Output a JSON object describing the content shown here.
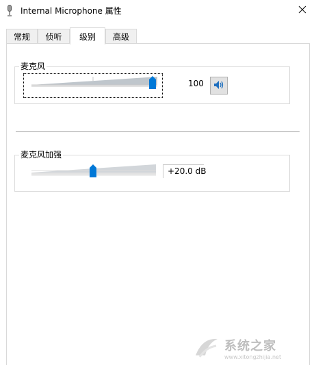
{
  "window": {
    "title": "Internal Microphone 属性",
    "icon": "microphone-icon",
    "close_icon": "close-icon"
  },
  "tabs": [
    {
      "label": "常规",
      "active": false
    },
    {
      "label": "侦听",
      "active": false
    },
    {
      "label": "级别",
      "active": true
    },
    {
      "label": "高级",
      "active": false
    }
  ],
  "microphone": {
    "label": "麦克风",
    "value": "100",
    "level_percent": 100,
    "speaker_icon": "speaker-icon"
  },
  "boost": {
    "label": "麦克风加强",
    "value": "+20.0 dB",
    "level_percent": 50
  },
  "watermark": {
    "text": "系统之家",
    "url": "www.xitongzhijia.net"
  },
  "colors": {
    "thumb": "#0078d7",
    "track": "#e2e2e2",
    "ramp": "#bfc6cc"
  }
}
